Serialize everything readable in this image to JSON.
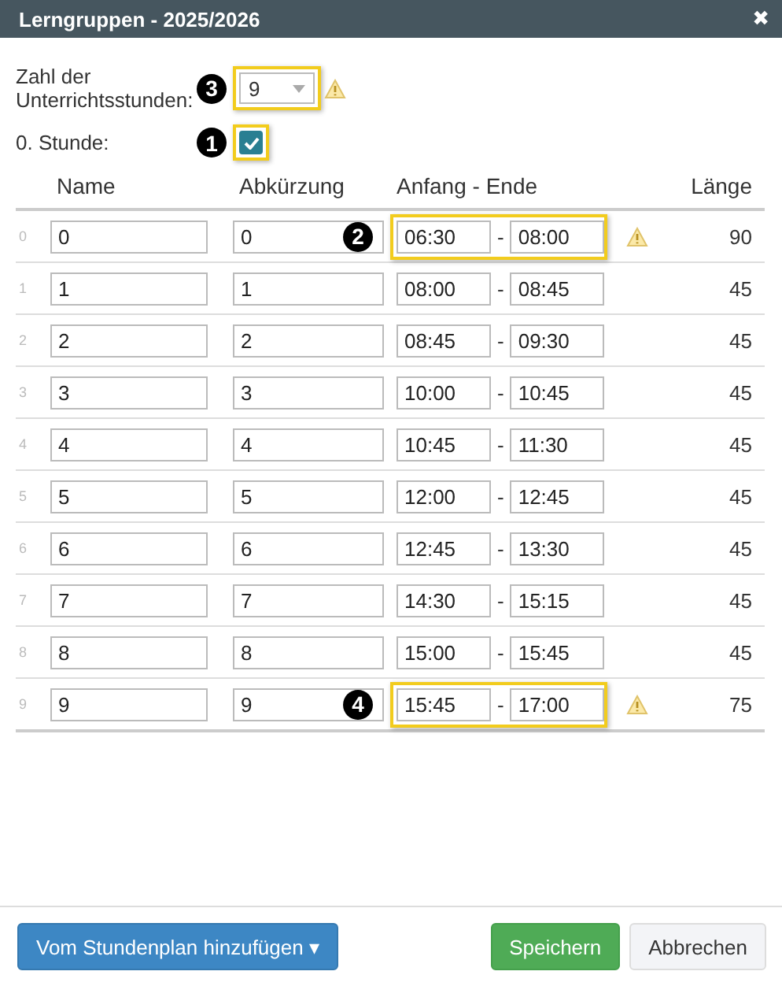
{
  "window": {
    "title": "Lerngruppen - 2025/2026",
    "close": "✖"
  },
  "form": {
    "count_label": "Zahl der Unterrichtsstunden:",
    "count_value": "9",
    "count_callout": "3",
    "count_highlighted": true,
    "count_warning": true,
    "zero_label": "0. Stunde:",
    "zero_checked": true,
    "zero_callout": "1",
    "zero_highlighted": true
  },
  "table": {
    "columns": [
      "Name",
      "Abkürzung",
      "Anfang - Ende",
      "Länge"
    ],
    "rows": [
      {
        "index": "0",
        "name": "0",
        "abbr": "0",
        "start": "06:30",
        "end": "08:00",
        "length": "90",
        "highlighted": true,
        "warning": true,
        "callout": "2"
      },
      {
        "index": "1",
        "name": "1",
        "abbr": "1",
        "start": "08:00",
        "end": "08:45",
        "length": "45",
        "highlighted": false,
        "warning": false
      },
      {
        "index": "2",
        "name": "2",
        "abbr": "2",
        "start": "08:45",
        "end": "09:30",
        "length": "45",
        "highlighted": false,
        "warning": false
      },
      {
        "index": "3",
        "name": "3",
        "abbr": "3",
        "start": "10:00",
        "end": "10:45",
        "length": "45",
        "highlighted": false,
        "warning": false
      },
      {
        "index": "4",
        "name": "4",
        "abbr": "4",
        "start": "10:45",
        "end": "11:30",
        "length": "45",
        "highlighted": false,
        "warning": false
      },
      {
        "index": "5",
        "name": "5",
        "abbr": "5",
        "start": "12:00",
        "end": "12:45",
        "length": "45",
        "highlighted": false,
        "warning": false
      },
      {
        "index": "6",
        "name": "6",
        "abbr": "6",
        "start": "12:45",
        "end": "13:30",
        "length": "45",
        "highlighted": false,
        "warning": false
      },
      {
        "index": "7",
        "name": "7",
        "abbr": "7",
        "start": "14:30",
        "end": "15:15",
        "length": "45",
        "highlighted": false,
        "warning": false
      },
      {
        "index": "8",
        "name": "8",
        "abbr": "8",
        "start": "15:00",
        "end": "15:45",
        "length": "45",
        "highlighted": false,
        "warning": false
      },
      {
        "index": "9",
        "name": "9",
        "abbr": "9",
        "start": "15:45",
        "end": "17:00",
        "length": "75",
        "highlighted": true,
        "warning": true,
        "callout": "4"
      }
    ],
    "separator": "-"
  },
  "footer": {
    "add_button": "Vom Stundenplan hinzufügen ▾",
    "save_button": "Speichern",
    "cancel_button": "Abbrechen"
  }
}
